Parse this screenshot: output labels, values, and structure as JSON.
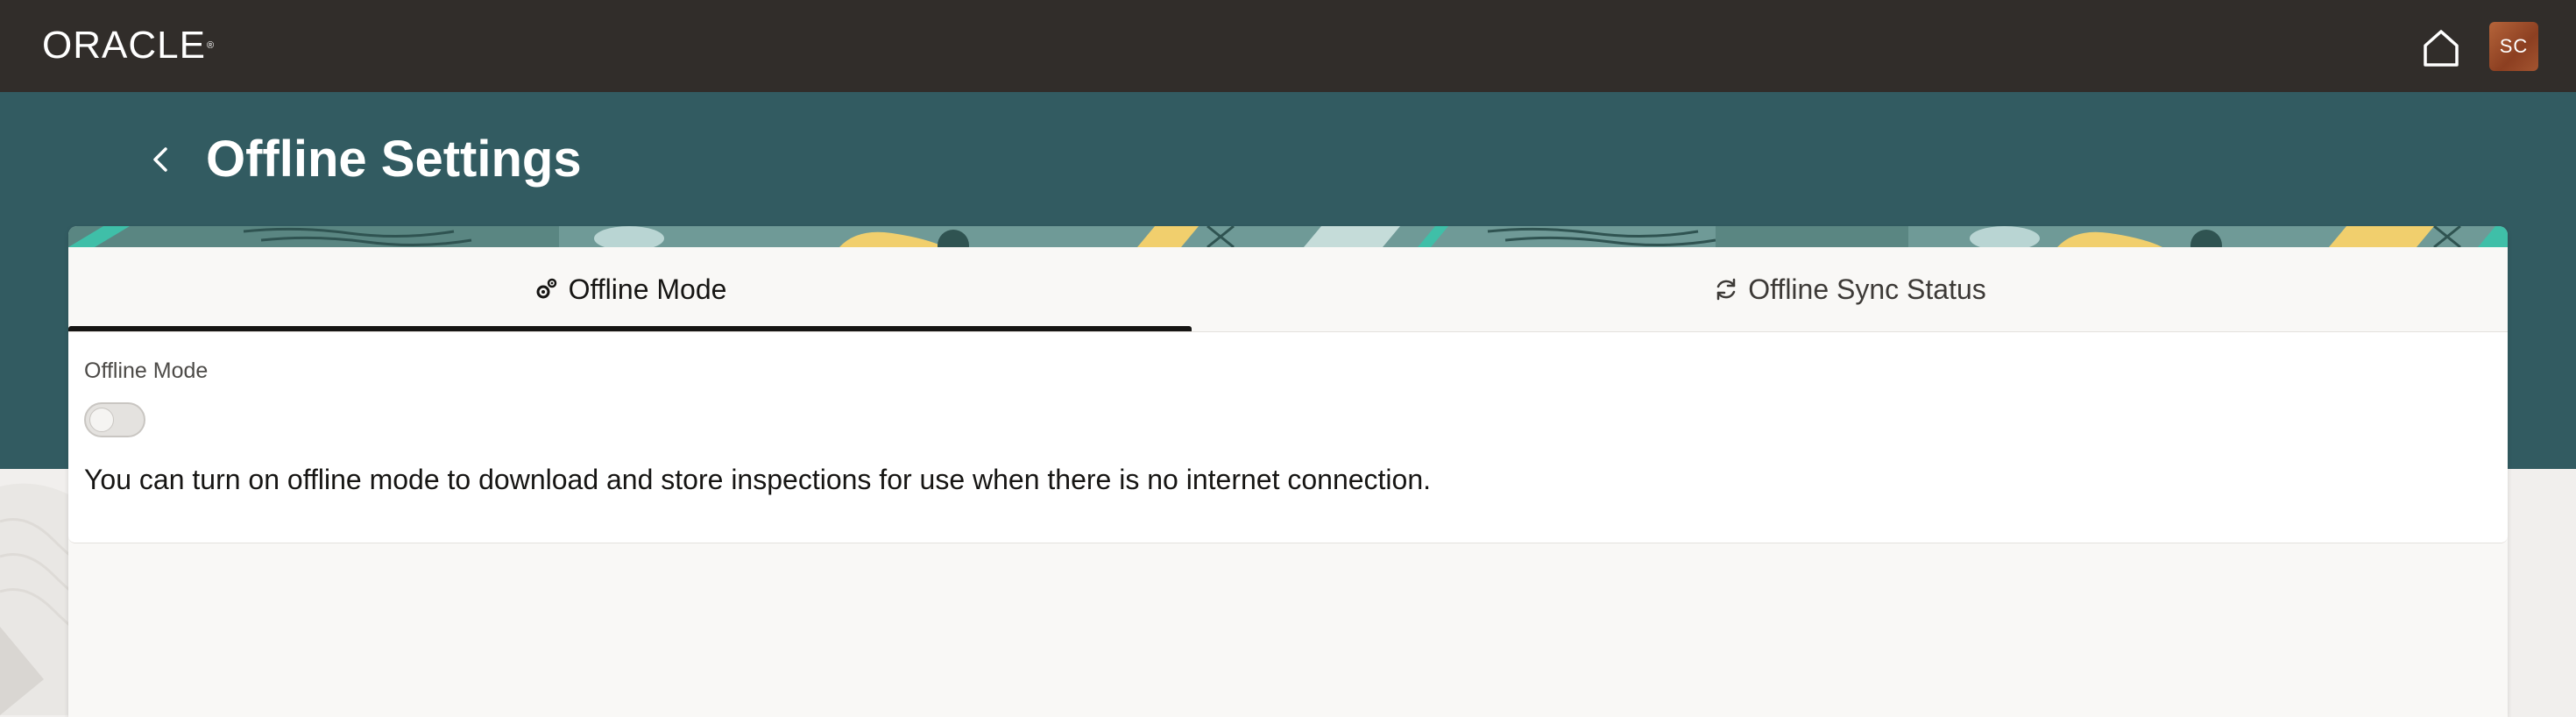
{
  "header": {
    "brand": "ORACLE",
    "brand_mark": "®",
    "home_icon": "home-icon",
    "avatar_initials": "SC",
    "colors": {
      "topbar": "#312d2a",
      "avatar": "#a0532e"
    }
  },
  "page": {
    "back_icon": "chevron-left-icon",
    "title": "Offline Settings",
    "colors": {
      "band": "#325b61"
    }
  },
  "tabs": [
    {
      "label": "Offline Mode",
      "icon": "gears-icon",
      "selected": true
    },
    {
      "label": "Offline Sync Status",
      "icon": "refresh-icon",
      "selected": false
    }
  ],
  "offline_mode_panel": {
    "field_label": "Offline Mode",
    "toggle_on": false,
    "help_text": "You can turn on offline mode to download and store inspections for use when there is no internet connection."
  }
}
